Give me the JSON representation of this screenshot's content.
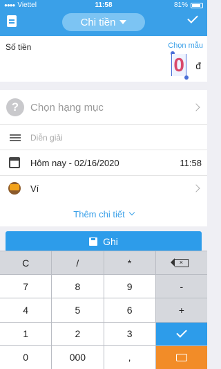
{
  "status_bar": {
    "carrier": "Viettel",
    "time": "11:58",
    "battery": "81%"
  },
  "header": {
    "title": "Chi tiền",
    "icons": [
      "document-icon",
      "chevron-down-icon",
      "check-icon"
    ]
  },
  "amount": {
    "label": "Số tiền",
    "sample_link": "Chọn mẫu",
    "value": "0",
    "currency": "đ",
    "value_color": "#d9496b"
  },
  "category": {
    "placeholder": "Chọn hạng mục"
  },
  "note": {
    "placeholder": "Diễn giải"
  },
  "date": {
    "label": "Hôm nay - 02/16/2020",
    "time": "11:58"
  },
  "wallet": {
    "label": "Ví"
  },
  "more_details": {
    "label": "Thêm chi tiết"
  },
  "save_button": {
    "label": "Ghi"
  },
  "keypad": {
    "keys": [
      "C",
      "/",
      "*",
      "",
      "7",
      "8",
      "9",
      "-",
      "4",
      "5",
      "6",
      "+",
      "1",
      "2",
      "3",
      "",
      "0",
      "000",
      ",",
      ""
    ]
  },
  "colors": {
    "accent": "#3aa0e8",
    "primary_button": "#2d9cea",
    "keyboard_toggle": "#f28c28"
  }
}
